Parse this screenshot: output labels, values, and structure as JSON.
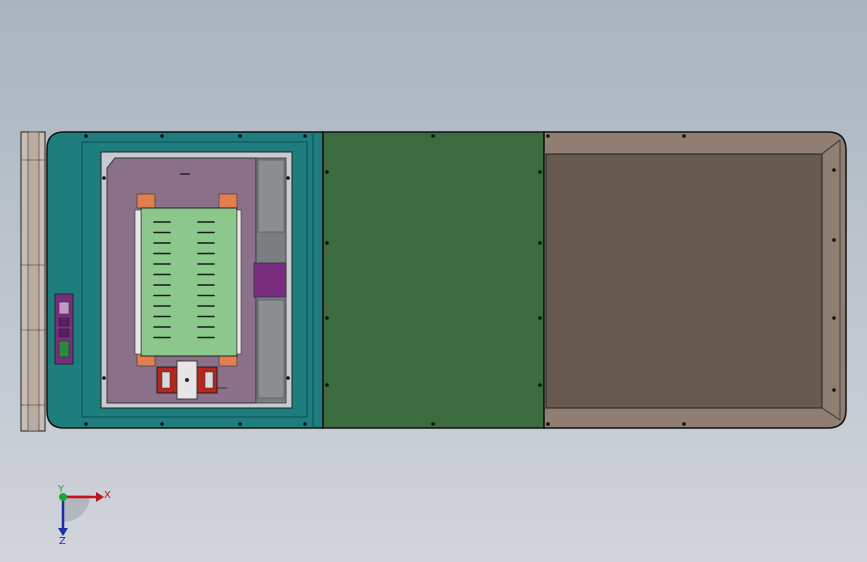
{
  "view": {
    "background_top": "#a9b3c0",
    "background_bottom": "#d2d5da"
  },
  "model": {
    "frame_color": "#1e7e7e",
    "end_cap_color": "#c9bdb3",
    "inner_panel_color": "#8a7088",
    "circuit_board_color": "#8cc88c",
    "green_panel_color": "#3b6b3f",
    "brown_panel_color": "#685a4f",
    "brown_frame_color": "#8f7e71",
    "connector_color": "#7a2e80",
    "red_block_color": "#b2271e",
    "mounting_tab_color": "#e08050"
  },
  "triad": {
    "x_axis_label": "X",
    "y_axis_label": "Y",
    "z_axis_label": "Z",
    "x_color": "#c0141c",
    "z_color": "#1a2ea8",
    "y_color": "#19a832"
  }
}
